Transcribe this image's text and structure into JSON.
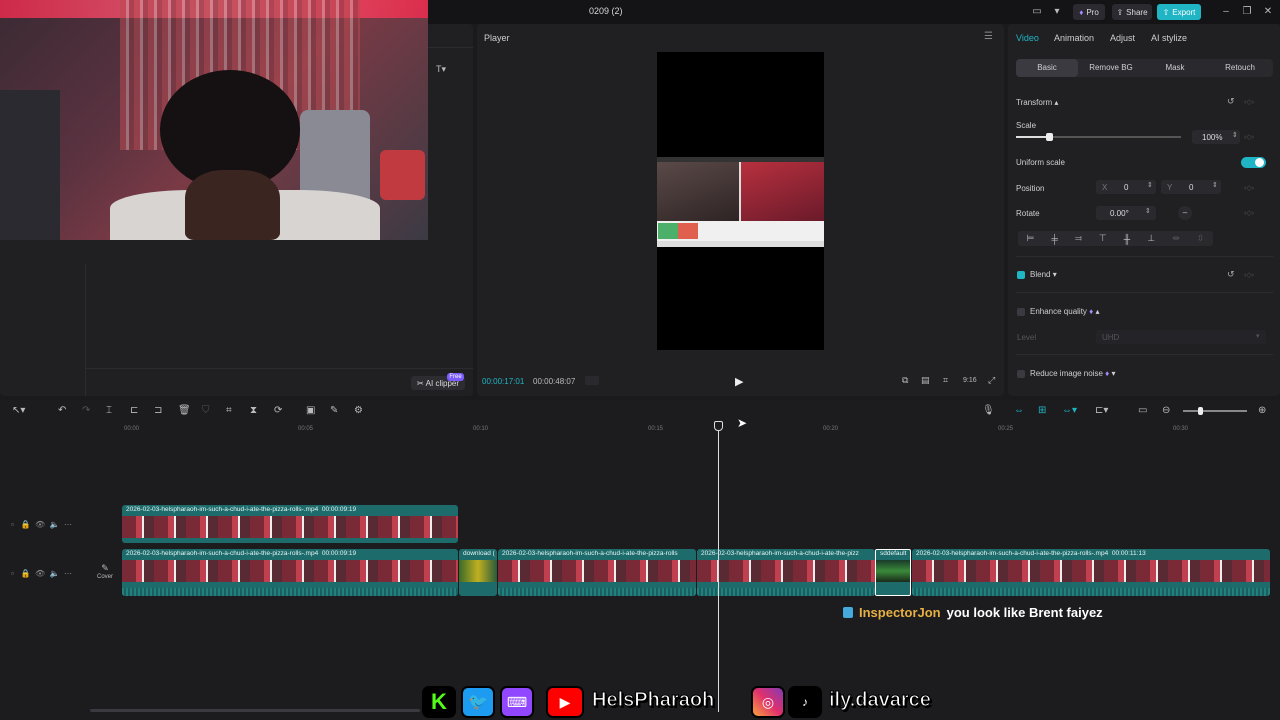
{
  "titlebar": {
    "doc_title": "0209 (2)",
    "pro_label": "Pro",
    "share_label": "Share",
    "export_label": "Export"
  },
  "media": {
    "ai_clipper_label": "AI clipper",
    "free_badge": "Free"
  },
  "player": {
    "title": "Player",
    "time_current": "00:00:17:01",
    "time_total": "00:00:48:07",
    "aspect_label": "9:16"
  },
  "props": {
    "tabs": [
      "Video",
      "Animation",
      "Adjust",
      "AI stylize"
    ],
    "subtabs": [
      "Basic",
      "Remove BG",
      "Mask",
      "Retouch"
    ],
    "transform_label": "Transform",
    "scale_label": "Scale",
    "scale_value": "100%",
    "scale_fraction": 0.2,
    "uniform_scale_label": "Uniform scale",
    "uniform_scale_on": true,
    "position_label": "Position",
    "x_label": "X",
    "x_value": "0",
    "y_label": "Y",
    "y_value": "0",
    "rotate_label": "Rotate",
    "rotate_value": "0.00°",
    "blend_label": "Blend",
    "enhance_label": "Enhance quality",
    "level_label": "Level",
    "level_value": "UHD",
    "noise_label": "Reduce image noise"
  },
  "timeline": {
    "ruler": [
      "00:00",
      "00:05",
      "00:10",
      "00:15",
      "00:20",
      "00:25",
      "00:30"
    ],
    "cover_label": "Cover",
    "track1_clip": {
      "name": "2026-02-03-helspharaoh-im-such-a-chud-i-ate-the-pizza-rolls-.mp4",
      "duration": "00:00:09:19"
    },
    "track2_clips": [
      {
        "name": "2026-02-03-helspharaoh-im-such-a-chud-i-ate-the-pizza-rolls-.mp4",
        "duration": "00:00:09:19"
      },
      {
        "name": "download (",
        "duration": ""
      },
      {
        "name": "2026-02-03-helspharaoh-im-such-a-chud-i-ate-the-pizza-rolls",
        "duration": ""
      },
      {
        "name": "2026-02-03-helspharaoh-im-such-a-chud-i-ate-the-pizz",
        "duration": ""
      },
      {
        "name": "sddefault",
        "duration": ""
      },
      {
        "name": "2026-02-03-helspharaoh-im-such-a-chud-i-ate-the-pizza-rolls-.mp4",
        "duration": "00:00:11:13"
      }
    ]
  },
  "chat": {
    "user": "InspectorJon",
    "message": "you look like Brent faiyez"
  },
  "social": {
    "handle1": "HelsPharaoh",
    "handle2": "ily.davarce"
  },
  "colors": {
    "accent": "#1fb5c4",
    "clip": "#1d6b6b",
    "chat_user": "#e8b040"
  }
}
